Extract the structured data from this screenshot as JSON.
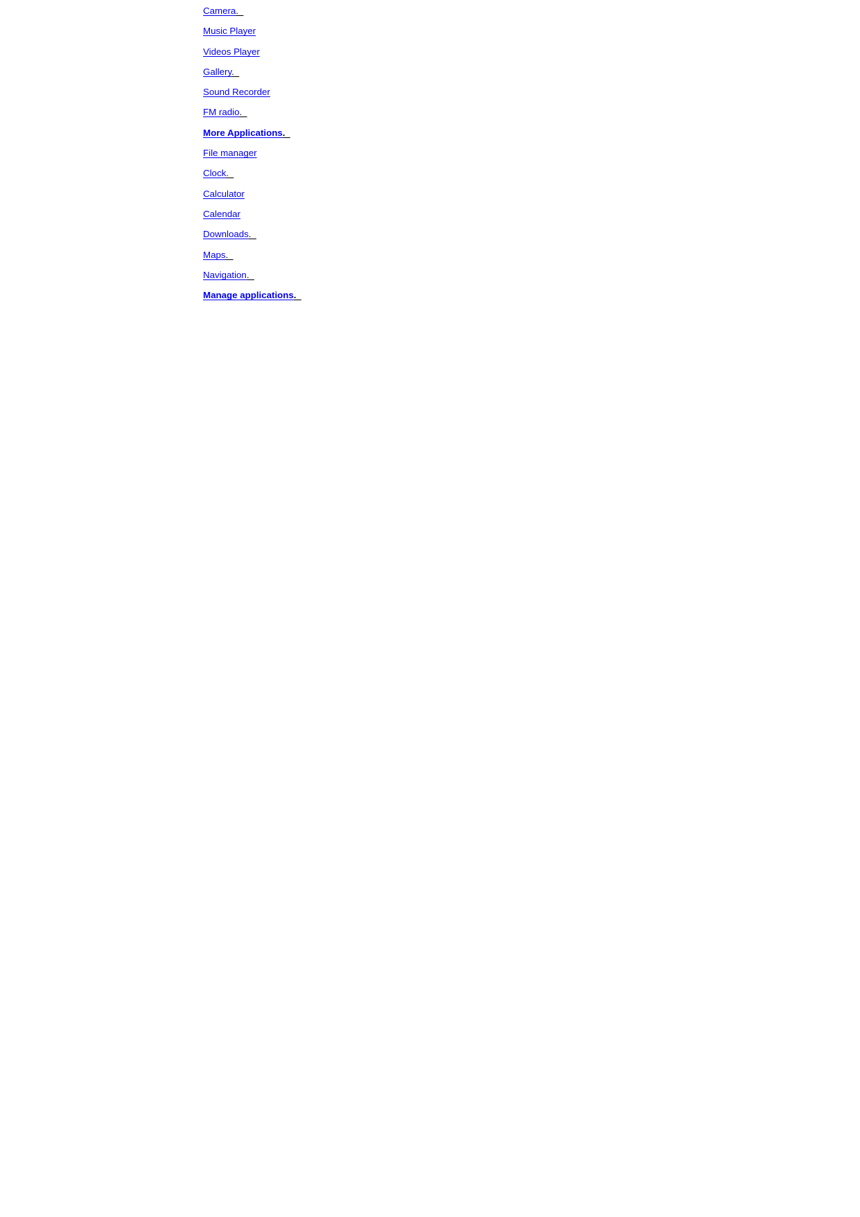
{
  "document": {
    "background_color": "#ffffff",
    "link_color": "#0000ee",
    "text_color": "#000000",
    "links": [
      {
        "label": "Camera",
        "tail": ".  ",
        "bold": false
      },
      {
        "label": "Music Player",
        "tail": "",
        "bold": false
      },
      {
        "label": "Videos Player",
        "tail": "",
        "bold": false
      },
      {
        "label": "Gallery",
        "tail": ".  ",
        "bold": false
      },
      {
        "label": "Sound Recorder",
        "tail": "",
        "bold": false
      },
      {
        "label": "FM radio",
        "tail": ".  ",
        "bold": false
      },
      {
        "label": "More Applications",
        "tail": ".  ",
        "bold": true
      },
      {
        "label": "File manager",
        "tail": "",
        "bold": false
      },
      {
        "label": "Clock",
        "tail": ".  ",
        "bold": false
      },
      {
        "label": "Calculator",
        "tail": "",
        "bold": false
      },
      {
        "label": "Calendar",
        "tail": "",
        "bold": false
      },
      {
        "label": "Downloads",
        "tail": ".  ",
        "bold": false
      },
      {
        "label": "Maps",
        "tail": ".  ",
        "bold": false
      },
      {
        "label": "Navigation",
        "tail": ".  ",
        "bold": false
      },
      {
        "label": "Manage applications",
        "tail": ".  ",
        "bold": true
      }
    ]
  }
}
